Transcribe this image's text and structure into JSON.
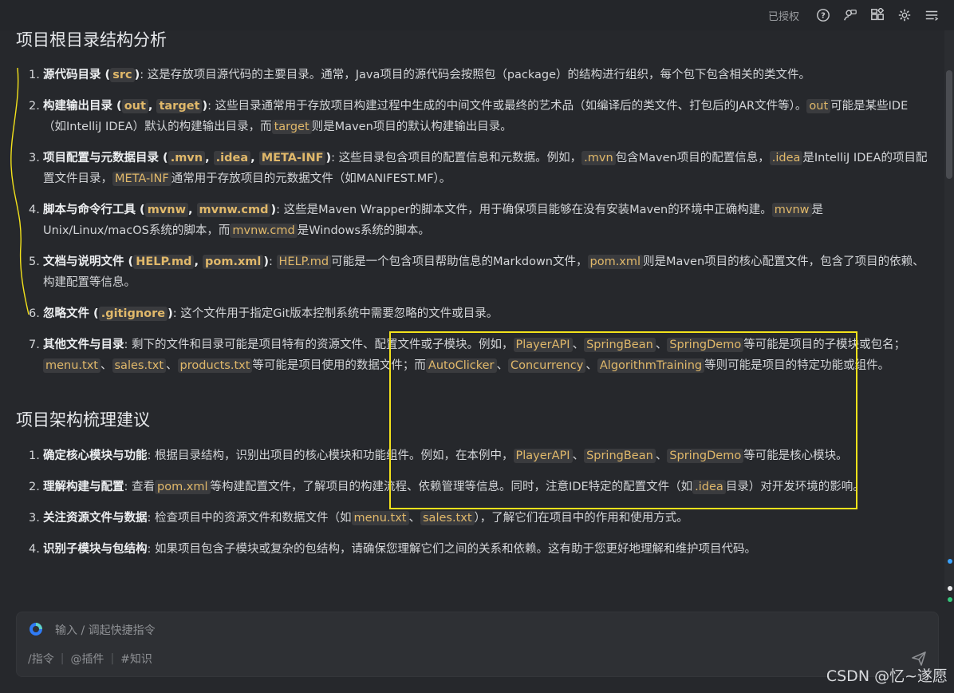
{
  "topbar": {
    "auth_label": "已授权",
    "icons": [
      "help-icon",
      "feedback-icon",
      "apps-icon",
      "settings-icon",
      "menu-icon"
    ]
  },
  "section1": {
    "title": "项目根目录结构分析",
    "items": [
      {
        "num": "1.",
        "title": "源代码目录 (",
        "codes": [
          "src"
        ],
        "title_end": ")",
        "text": ": 这是存放项目源代码的主要目录。通常，Java项目的源代码会按照包（package）的结构进行组织，每个包下包含相关的类文件。"
      },
      {
        "num": "2.",
        "title": "构建输出目录 (",
        "code1": "out",
        "comma": ", ",
        "code2": "target",
        "title_end": ")",
        "text1": ": 这些目录通常用于存放项目构建过程中生成的中间文件或最终的艺术品（如编译后的类文件、打包后的JAR文件等）。",
        "code3": "out",
        "text2": "可能是某些IDE（如IntelliJ IDEA）默认的构建输出目录，而",
        "code4": "target",
        "text3": "则是Maven项目的默认构建输出目录。"
      },
      {
        "num": "3.",
        "title": "项目配置与元数据目录 (",
        "code1": ".mvn",
        "code2": ".idea",
        "code3": "META-INF",
        "title_end": ")",
        "text1": ": 这些目录包含项目的配置信息和元数据。例如，",
        "code4": ".mvn",
        "text2": "包含Maven项目的配置信息，",
        "code5": ".idea",
        "text3": "是IntelliJ IDEA的项目配置文件目录，",
        "code6": "META-INF",
        "text4": "通常用于存放项目的元数据文件（如MANIFEST.MF）。"
      },
      {
        "num": "4.",
        "title": "脚本与命令行工具 (",
        "code1": "mvnw",
        "code2": "mvnw.cmd",
        "title_end": ")",
        "text1": ": 这些是Maven Wrapper的脚本文件，用于确保项目能够在没有安装Maven的环境中正确构建。",
        "code3": "mvnw",
        "text2": "是Unix/Linux/macOS系统的脚本，而",
        "code4": "mvnw.cmd",
        "text3": "是Windows系统的脚本。"
      },
      {
        "num": "5.",
        "title": "文档与说明文件 (",
        "code1": "HELP.md",
        "code2": "pom.xml",
        "title_end": ")",
        "text0": ": ",
        "code3": "HELP.md",
        "text1": "可能是一个包含项目帮助信息的Markdown文件，",
        "code4": "pom.xml",
        "text2": "则是Maven项目的核心配置文件，包含了项目的依赖、构建配置等信息。"
      },
      {
        "num": "6.",
        "title": "忽略文件 (",
        "code1": ".gitignore",
        "title_end": ")",
        "text1": ": 这个文件用于指定Git版本控制系统中需要忽略的文件或目录。"
      },
      {
        "num": "7.",
        "title": "其他文件与目录",
        "text1": ": 剩下的文件和目录可能是项目特有的资源文件、配置文件或子模块。例如，",
        "code1": "PlayerAPI",
        "sep": "、",
        "code2": "SpringBean",
        "code3": "SpringDemo",
        "text2": "等可能是项目的子模块或包名；",
        "code4": "menu.txt",
        "code5": "sales.txt",
        "code6": "products.txt",
        "text3": "等可能是项目使用的数据文件；而",
        "code7": "AutoClicker",
        "code8": "Concurrency",
        "code9": "AlgorithmTraining",
        "text4": "等则可能是项目的特定功能或组件。"
      }
    ]
  },
  "section2": {
    "title": "项目架构梳理建议",
    "items": [
      {
        "num": "1.",
        "title": "确定核心模块与功能",
        "text1": ": 根据目录结构，识别出项目的核心模块和功能组件。例如，在本例中，",
        "code1": "PlayerAPI",
        "code2": "SpringBean",
        "code3": "SpringDemo",
        "text2": "等可能是核心模块。"
      },
      {
        "num": "2.",
        "title": "理解构建与配置",
        "text1": ": 查看",
        "code1": "pom.xml",
        "text2": "等构建配置文件，了解项目的构建流程、依赖管理等信息。同时，注意IDE特定的配置文件（如",
        "code2": ".idea",
        "text3": "目录）对开发环境的影响。"
      },
      {
        "num": "3.",
        "title": "关注资源文件与数据",
        "text1": ": 检查项目中的资源文件和数据文件（如",
        "code1": "menu.txt",
        "code2": "sales.txt",
        "text2": "），了解它们在项目中的作用和使用方式。"
      },
      {
        "num": "4.",
        "title": "识别子模块与包结构",
        "text1": ": 如果项目包含子模块或复杂的包结构，请确保您理解它们之间的关系和依赖。这有助于您更好地理解和维护项目代码。"
      }
    ]
  },
  "composer": {
    "placeholder": "输入 / 调起快捷指令",
    "tool1": "/指令",
    "tool2": "@插件",
    "tool3": "#知识",
    "sep": "|"
  },
  "watermark": "CSDN @忆~遂愿",
  "colors": {
    "background": "#26282c",
    "code_text": "#e0b86a",
    "code_bg": "#3a3b3e",
    "annotation": "#f3e21b"
  }
}
